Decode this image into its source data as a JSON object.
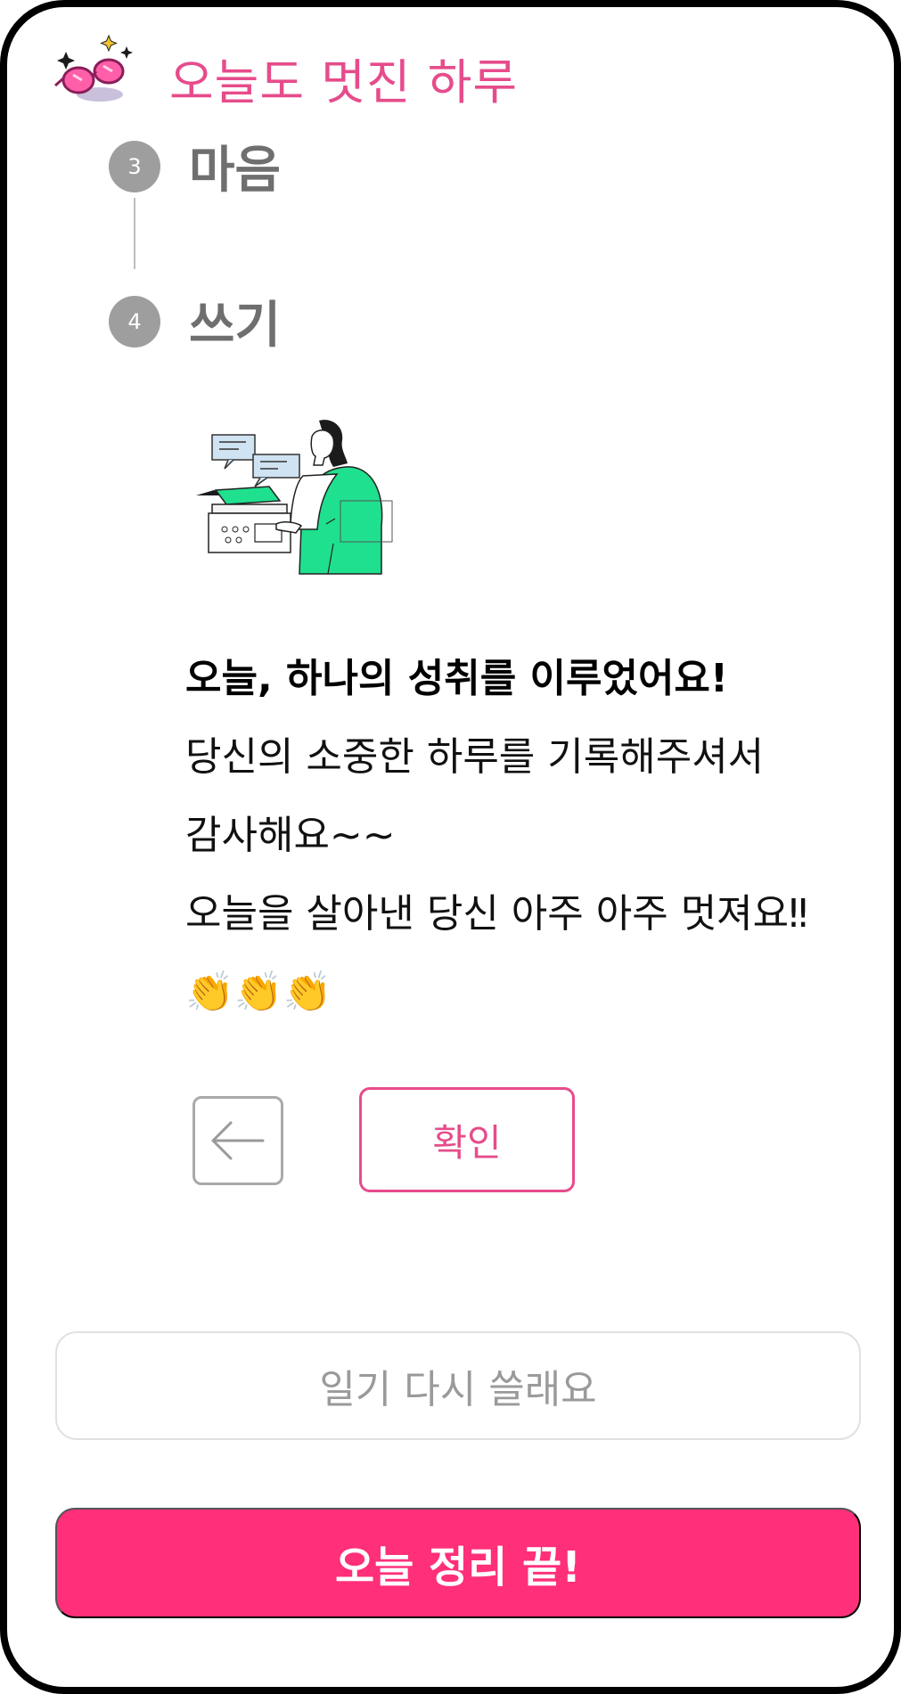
{
  "header": {
    "title": "오늘도 멋진 하루",
    "logo_icon": "sparkle-glasses-icon"
  },
  "steps": [
    {
      "number": "3",
      "label": "마음"
    },
    {
      "number": "4",
      "label": "쓰기"
    }
  ],
  "illustration": {
    "icon": "person-typing-illustration"
  },
  "message": {
    "title": "오늘, 하나의 성취를 이루었어요!",
    "body": "당신의 소중한 하루를 기록해주셔서 감사해요~~\n오늘을 살아낸 당신 아주 아주 멋져요‼👏👏👏"
  },
  "buttons": {
    "back_icon": "arrow-left-icon",
    "confirm": "확인",
    "rewrite": "일기 다시 쓸래요",
    "finish": "오늘 정리 끝!"
  },
  "colors": {
    "brand_pink": "#e64c8b",
    "primary": "#ff2f7a",
    "step_gray": "#9e9e9e",
    "accent_green": "#1fe08f"
  }
}
